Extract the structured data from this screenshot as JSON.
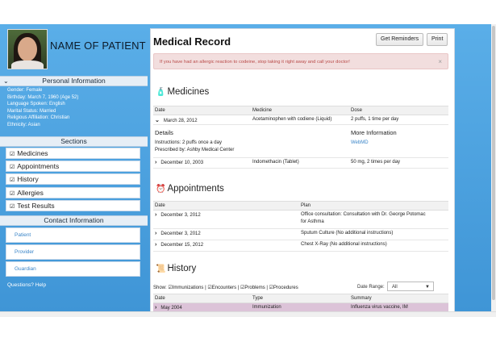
{
  "patient": {
    "name": "NAME OF PATIENT",
    "personal_info_heading": "Personal Information",
    "info": [
      "Gender: Female",
      "Birthday: March 7, 1960 (Age 52)",
      "Language Spoken: English",
      "Marital Status: Married",
      "Religious Affiliation: Christian",
      "Ethnicity: Asian"
    ]
  },
  "sidebar": {
    "sections_heading": "Sections",
    "sections": [
      "Medicines",
      "Appointments",
      "History",
      "Allergies",
      "Test Results"
    ],
    "contact_heading": "Contact Information",
    "contacts": [
      "Patient",
      "Provider",
      "Guardian"
    ],
    "help": "Questions? Help"
  },
  "record": {
    "title": "Medical Record",
    "get_reminders": "Get Reminders",
    "print": "Print",
    "alert": "If you have had an allergic reaction to codeine, stop taking it right away and call your doctor!",
    "alert_close": "×"
  },
  "medicines": {
    "heading": "Medicines",
    "columns": [
      "Date",
      "Medicine",
      "Dose"
    ],
    "rows": [
      {
        "date": "March 28, 2012",
        "medicine": "Acetaminophen with codiene (Liquid)",
        "dose": "2 puffs, 1 time per day"
      },
      {
        "date": "December 10, 2003",
        "medicine": "Indomethacin (Tablet)",
        "dose": "50 mg, 2 times per day"
      }
    ],
    "details_label": "Details",
    "details_lines": [
      "Instructions: 2 puffs once a day",
      "Prescribed by: Ashby Medical Center"
    ],
    "more_info_label": "More Information",
    "more_info_link": "WebMD"
  },
  "appointments": {
    "heading": "Appointments",
    "columns": [
      "Date",
      "Plan"
    ],
    "rows": [
      {
        "date": "December 3, 2012",
        "plan": "Office consultation: Consultation with Dr. George Potomac",
        "plan2": "for Asthma"
      },
      {
        "date": "December 3, 2012",
        "plan": "Sputum Culture (No additional instructions)"
      },
      {
        "date": "December 15, 2012",
        "plan": "Chest X-Ray (No additional instructions)"
      }
    ]
  },
  "history": {
    "heading": "History",
    "show_label": "Show:",
    "filters": [
      "Immunizations",
      "Encounters",
      "Problems",
      "Procedures"
    ],
    "date_range_label": "Date Range:",
    "date_range_value": "All",
    "columns": [
      "Date",
      "Type",
      "Summary"
    ],
    "rows": [
      {
        "date": "May 2004",
        "type": "Immunization",
        "summary": "Influenza virus vaccine, IM"
      }
    ]
  }
}
